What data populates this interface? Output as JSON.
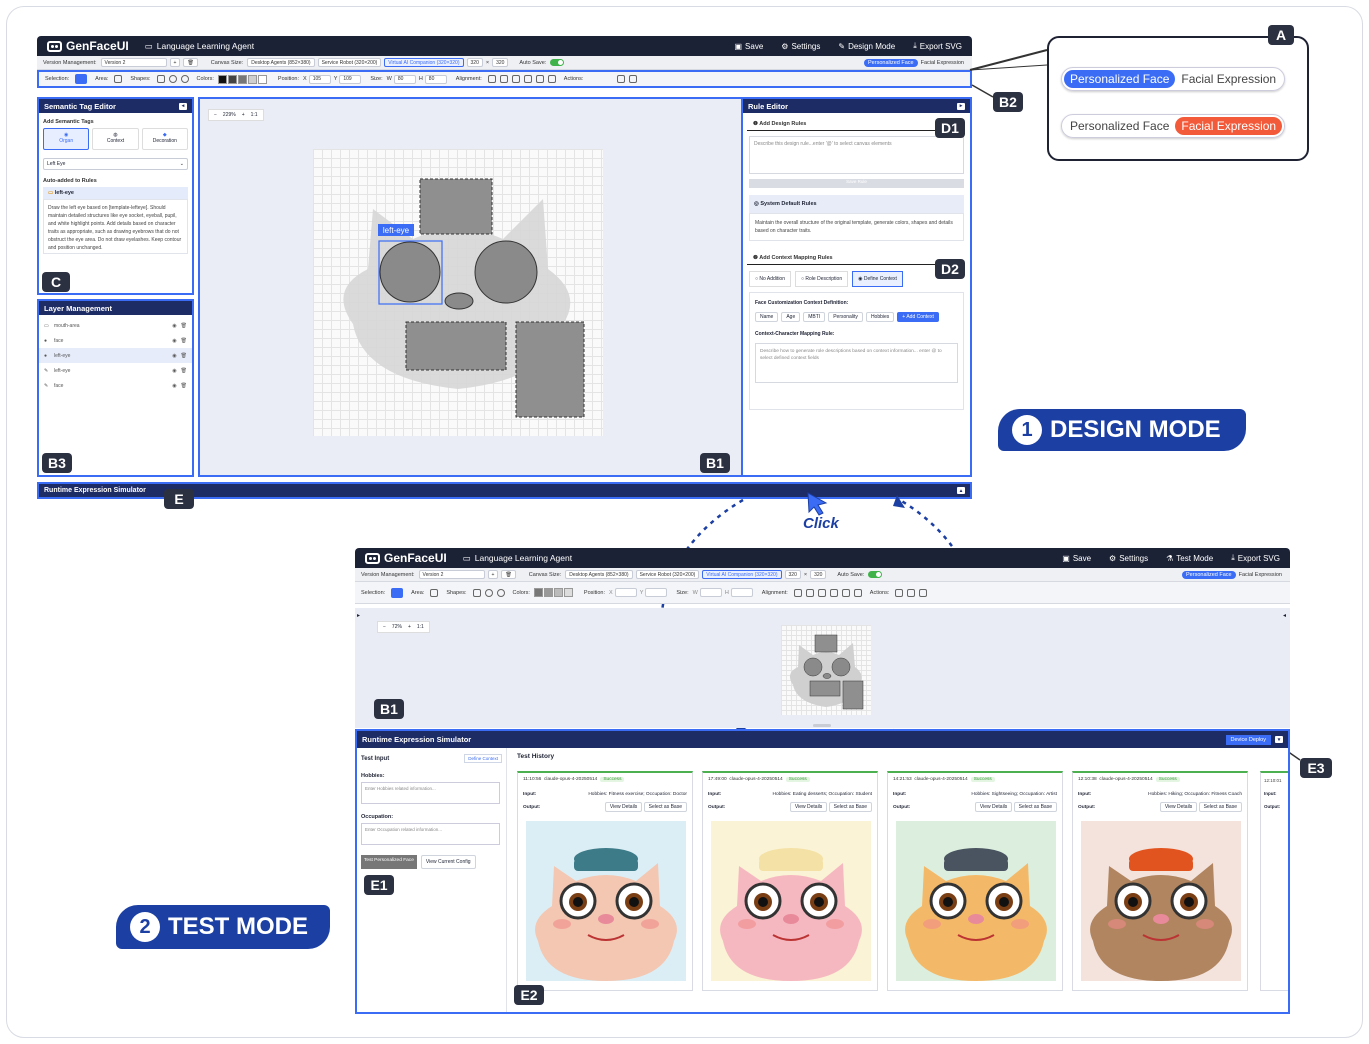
{
  "app": {
    "logo": "GenFaceUI",
    "title": "Language Learning Agent",
    "save": "Save",
    "settings": "Settings",
    "design_mode": "Design Mode",
    "test_mode": "Test Mode",
    "export": "Export SVG"
  },
  "toolbar": {
    "version_label": "Version Management:",
    "version_value": "Version 2",
    "canvas_label": "Canvas Size:",
    "canvas_opts": [
      "Desktop Agents (852×380)",
      "Service Robot (320×200)",
      "Virtual AI Companion (320×320)"
    ],
    "w": "320",
    "h": "320",
    "autosave": "Auto Save:",
    "mode_a": "Personalized Face",
    "mode_b": "Facial Expression"
  },
  "tools": {
    "selection": "Selection:",
    "area": "Area:",
    "shapes": "Shapes:",
    "colors": "Colors:",
    "position": "Position:",
    "px": "X",
    "px_val": "105",
    "py": "Y",
    "py_val": "109",
    "size": "Size:",
    "sw": "W",
    "sw_val": "80",
    "sh": "H",
    "sh_val": "80",
    "alignment": "Alignment:",
    "actions": "Actions:",
    "swatches": [
      "#111111",
      "#444444",
      "#777777",
      "#cfcfcf",
      "#ffffff"
    ]
  },
  "tag_editor": {
    "title": "Semantic Tag Editor",
    "add": "Add Semantic Tags",
    "tabs": [
      "Organ",
      "Context",
      "Decoration"
    ],
    "select": "Left Eye",
    "auto": "Auto-added to Rules",
    "tag": "left-eye",
    "desc": "Draw the left eye based on [template-lefteye]. Should maintain detailed structures like eye socket, eyeball, pupil, and white highlight points. Add details based on character traits as appropriate, such as drawing eyebrows that do not obstruct the eye area. Do not draw eyelashes. Keep contour and position unchanged."
  },
  "layers": {
    "title": "Layer Management",
    "items": [
      "mouth-area",
      "face",
      "left-eye",
      "left-eye",
      "face"
    ]
  },
  "canvas": {
    "zoom": "229%",
    "minus": "−",
    "plus": "+",
    "reset": "1:1",
    "label": "left-eye"
  },
  "rules": {
    "title": "Rule Editor",
    "add_design": "Add Design Rules",
    "placeholder": "Describe this design rule...enter '@' to select canvas elements",
    "save": "Save Rule",
    "sys": "System Default Rules",
    "sys_desc": "Maintain the overall structure of the original template, generate colors, shapes and details based on character traits.",
    "add_ctx": "Add Context Mapping Rules",
    "opts": [
      "No Addition",
      "Role Description",
      "Define Context"
    ],
    "ctx_title": "Face Customization Context Definition:",
    "ctx_tags": [
      "Name",
      "Age",
      "MBTI",
      "Personality",
      "Hobbies"
    ],
    "add_ctx_btn": "+ Add Context",
    "map_title": "Context-Character Mapping Rule:",
    "map_ph": "Describe how to generate role descriptions based on context information... enter @ to select defined context fields"
  },
  "simulator": {
    "title": "Runtime Expression Simulator",
    "deploy": "Device Deploy",
    "test_input": "Test Input",
    "define_ctx": "Define Context",
    "hobbies": "Hobbies:",
    "hobbies_ph": "Enter Hobbies related information...",
    "occupation": "Occupation:",
    "occ_ph": "Enter Occupation related information...",
    "test_btn": "Test Personalized Face",
    "view_btn": "View Current Config",
    "history": "Test History",
    "zoom": "72%",
    "cards": [
      {
        "time": "11:10:56",
        "model": "claude-opus-4-20250514",
        "status": "Success",
        "input_label": "Input:",
        "input": "Hobbies: Fitness exercise; Occupation: Doctor",
        "output_label": "Output:",
        "details": "View Details",
        "base": "Select as Base",
        "bg": "#dceef5",
        "face": "#f3c7b2",
        "hat": "#3d7b88"
      },
      {
        "time": "17:49:00",
        "model": "claude-opus-4-20250514",
        "status": "Success",
        "input_label": "Input:",
        "input": "Hobbies: Eating desserts; Occupation: Student",
        "output_label": "Output:",
        "details": "View Details",
        "base": "Select as Base",
        "bg": "#fbf3d6",
        "face": "#f6b8c0",
        "hat": "#f4e1a6"
      },
      {
        "time": "14:21:53",
        "model": "claude-opus-4-20250514",
        "status": "Success",
        "input_label": "Input:",
        "input": "Hobbies: Sightseeing; Occupation: Artist",
        "output_label": "Output:",
        "details": "View Details",
        "base": "Select as Base",
        "bg": "#dcefdf",
        "face": "#f4b968",
        "hat": "#4a5360"
      },
      {
        "time": "12:10:38",
        "model": "claude-opus-4-20250514",
        "status": "Success",
        "input_label": "Input:",
        "input": "Hobbies: Hiking; Occupation: Fitness Coach",
        "output_label": "Output:",
        "details": "View Details",
        "base": "Select as Base",
        "bg": "#f4e2dc",
        "face": "#b08560",
        "hat": "#e2541f"
      }
    ],
    "partial_time": "12:10:01",
    "partial_input": "Input:",
    "partial_output": "Output:"
  },
  "callout": {
    "a": "A",
    "b1": "B1",
    "b2": "B2",
    "b3": "B3",
    "c": "C",
    "d1": "D1",
    "d2": "D2",
    "e": "E",
    "e1": "E1",
    "e2": "E2",
    "e3": "E3",
    "pa": "Personalized Face",
    "pb": "Facial Expression"
  },
  "modes": {
    "design_num": "1",
    "design": "DESIGN MODE",
    "test_num": "2",
    "test": "TEST MODE",
    "click": "Click"
  }
}
